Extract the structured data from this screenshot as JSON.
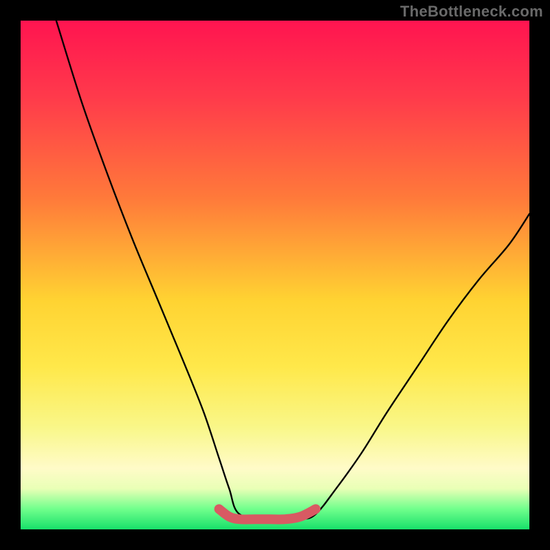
{
  "watermark": "TheBottleneck.com",
  "chart_data": {
    "type": "line",
    "title": "",
    "xlabel": "",
    "ylabel": "",
    "xlim": [
      0,
      100
    ],
    "ylim": [
      0,
      100
    ],
    "series": [
      {
        "name": "curve",
        "x": [
          7,
          12,
          17,
          22,
          27,
          32,
          36,
          39,
          41,
          43,
          49,
          55,
          58,
          62,
          67,
          72,
          78,
          84,
          90,
          96,
          100
        ],
        "y": [
          100,
          84,
          70,
          57,
          45,
          33,
          23,
          14,
          8,
          3,
          2,
          2,
          3,
          8,
          15,
          23,
          32,
          41,
          49,
          56,
          62
        ]
      },
      {
        "name": "valley-highlight",
        "x": [
          39,
          41,
          43,
          46,
          49,
          52,
          55,
          58
        ],
        "y": [
          4,
          2.5,
          2,
          2,
          2,
          2,
          2.5,
          4
        ]
      }
    ],
    "colors": {
      "curve": "#000000",
      "valley": "#d85a63",
      "gradient_top": "#ff1450",
      "gradient_bottom": "#17e06a"
    }
  }
}
